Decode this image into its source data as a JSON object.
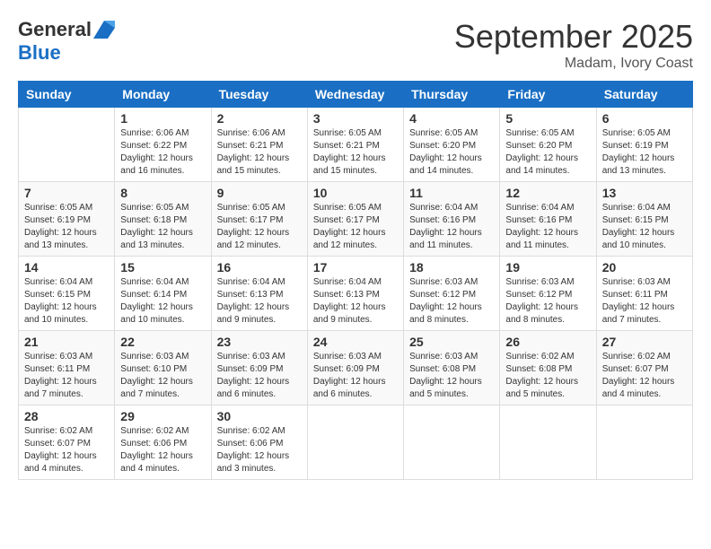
{
  "header": {
    "logo_general": "General",
    "logo_blue": "Blue",
    "month_title": "September 2025",
    "subtitle": "Madam, Ivory Coast"
  },
  "weekdays": [
    "Sunday",
    "Monday",
    "Tuesday",
    "Wednesday",
    "Thursday",
    "Friday",
    "Saturday"
  ],
  "weeks": [
    [
      {
        "day": "",
        "sunrise": "",
        "sunset": "",
        "daylight": ""
      },
      {
        "day": "1",
        "sunrise": "6:06 AM",
        "sunset": "6:22 PM",
        "daylight": "12 hours and 16 minutes."
      },
      {
        "day": "2",
        "sunrise": "6:06 AM",
        "sunset": "6:21 PM",
        "daylight": "12 hours and 15 minutes."
      },
      {
        "day": "3",
        "sunrise": "6:05 AM",
        "sunset": "6:21 PM",
        "daylight": "12 hours and 15 minutes."
      },
      {
        "day": "4",
        "sunrise": "6:05 AM",
        "sunset": "6:20 PM",
        "daylight": "12 hours and 14 minutes."
      },
      {
        "day": "5",
        "sunrise": "6:05 AM",
        "sunset": "6:20 PM",
        "daylight": "12 hours and 14 minutes."
      },
      {
        "day": "6",
        "sunrise": "6:05 AM",
        "sunset": "6:19 PM",
        "daylight": "12 hours and 13 minutes."
      }
    ],
    [
      {
        "day": "7",
        "sunrise": "6:05 AM",
        "sunset": "6:19 PM",
        "daylight": "12 hours and 13 minutes."
      },
      {
        "day": "8",
        "sunrise": "6:05 AM",
        "sunset": "6:18 PM",
        "daylight": "12 hours and 13 minutes."
      },
      {
        "day": "9",
        "sunrise": "6:05 AM",
        "sunset": "6:17 PM",
        "daylight": "12 hours and 12 minutes."
      },
      {
        "day": "10",
        "sunrise": "6:05 AM",
        "sunset": "6:17 PM",
        "daylight": "12 hours and 12 minutes."
      },
      {
        "day": "11",
        "sunrise": "6:04 AM",
        "sunset": "6:16 PM",
        "daylight": "12 hours and 11 minutes."
      },
      {
        "day": "12",
        "sunrise": "6:04 AM",
        "sunset": "6:16 PM",
        "daylight": "12 hours and 11 minutes."
      },
      {
        "day": "13",
        "sunrise": "6:04 AM",
        "sunset": "6:15 PM",
        "daylight": "12 hours and 10 minutes."
      }
    ],
    [
      {
        "day": "14",
        "sunrise": "6:04 AM",
        "sunset": "6:15 PM",
        "daylight": "12 hours and 10 minutes."
      },
      {
        "day": "15",
        "sunrise": "6:04 AM",
        "sunset": "6:14 PM",
        "daylight": "12 hours and 10 minutes."
      },
      {
        "day": "16",
        "sunrise": "6:04 AM",
        "sunset": "6:13 PM",
        "daylight": "12 hours and 9 minutes."
      },
      {
        "day": "17",
        "sunrise": "6:04 AM",
        "sunset": "6:13 PM",
        "daylight": "12 hours and 9 minutes."
      },
      {
        "day": "18",
        "sunrise": "6:03 AM",
        "sunset": "6:12 PM",
        "daylight": "12 hours and 8 minutes."
      },
      {
        "day": "19",
        "sunrise": "6:03 AM",
        "sunset": "6:12 PM",
        "daylight": "12 hours and 8 minutes."
      },
      {
        "day": "20",
        "sunrise": "6:03 AM",
        "sunset": "6:11 PM",
        "daylight": "12 hours and 7 minutes."
      }
    ],
    [
      {
        "day": "21",
        "sunrise": "6:03 AM",
        "sunset": "6:11 PM",
        "daylight": "12 hours and 7 minutes."
      },
      {
        "day": "22",
        "sunrise": "6:03 AM",
        "sunset": "6:10 PM",
        "daylight": "12 hours and 7 minutes."
      },
      {
        "day": "23",
        "sunrise": "6:03 AM",
        "sunset": "6:09 PM",
        "daylight": "12 hours and 6 minutes."
      },
      {
        "day": "24",
        "sunrise": "6:03 AM",
        "sunset": "6:09 PM",
        "daylight": "12 hours and 6 minutes."
      },
      {
        "day": "25",
        "sunrise": "6:03 AM",
        "sunset": "6:08 PM",
        "daylight": "12 hours and 5 minutes."
      },
      {
        "day": "26",
        "sunrise": "6:02 AM",
        "sunset": "6:08 PM",
        "daylight": "12 hours and 5 minutes."
      },
      {
        "day": "27",
        "sunrise": "6:02 AM",
        "sunset": "6:07 PM",
        "daylight": "12 hours and 4 minutes."
      }
    ],
    [
      {
        "day": "28",
        "sunrise": "6:02 AM",
        "sunset": "6:07 PM",
        "daylight": "12 hours and 4 minutes."
      },
      {
        "day": "29",
        "sunrise": "6:02 AM",
        "sunset": "6:06 PM",
        "daylight": "12 hours and 4 minutes."
      },
      {
        "day": "30",
        "sunrise": "6:02 AM",
        "sunset": "6:06 PM",
        "daylight": "12 hours and 3 minutes."
      },
      {
        "day": "",
        "sunrise": "",
        "sunset": "",
        "daylight": ""
      },
      {
        "day": "",
        "sunrise": "",
        "sunset": "",
        "daylight": ""
      },
      {
        "day": "",
        "sunrise": "",
        "sunset": "",
        "daylight": ""
      },
      {
        "day": "",
        "sunrise": "",
        "sunset": "",
        "daylight": ""
      }
    ]
  ]
}
